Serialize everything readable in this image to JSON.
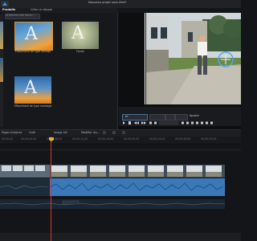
{
  "window": {
    "title": "Nouveau projet sans titre*"
  },
  "tabs": [
    {
      "label": "Produits"
    },
    {
      "label": "Créer un disque"
    }
  ],
  "library": {
    "search_placeholder": "Rechercher dans l...",
    "thumbs": [
      {
        "caption": "Effacement de type horloge",
        "letter": "A"
      },
      {
        "caption": "Fondu",
        "letter": "A"
      },
      {
        "caption": "Effacement de type montage",
        "letter": "A"
      }
    ]
  },
  "preview": {
    "controls_label": "Ajuster",
    "fit_label": "Fit"
  },
  "timeline_toolbar": {
    "items": [
      {
        "label": "Outil"
      },
      {
        "label": "Image clé"
      },
      {
        "label": "Modifier les..."
      }
    ],
    "track_label": "Pages histoires"
  },
  "ruler": {
    "labels": [
      "00;00;00",
      "00;00;04;00",
      "00;00;08;00",
      "00;00;12;00",
      "00;00;16;00",
      "00;00;20;00",
      "00;00;24;00",
      "00;00;28;00",
      "00;00;32;00"
    ]
  },
  "colors": {
    "accent": "#3d8ee6",
    "clip_audio": "#3b78b8",
    "playhead": "#d23a2f"
  }
}
